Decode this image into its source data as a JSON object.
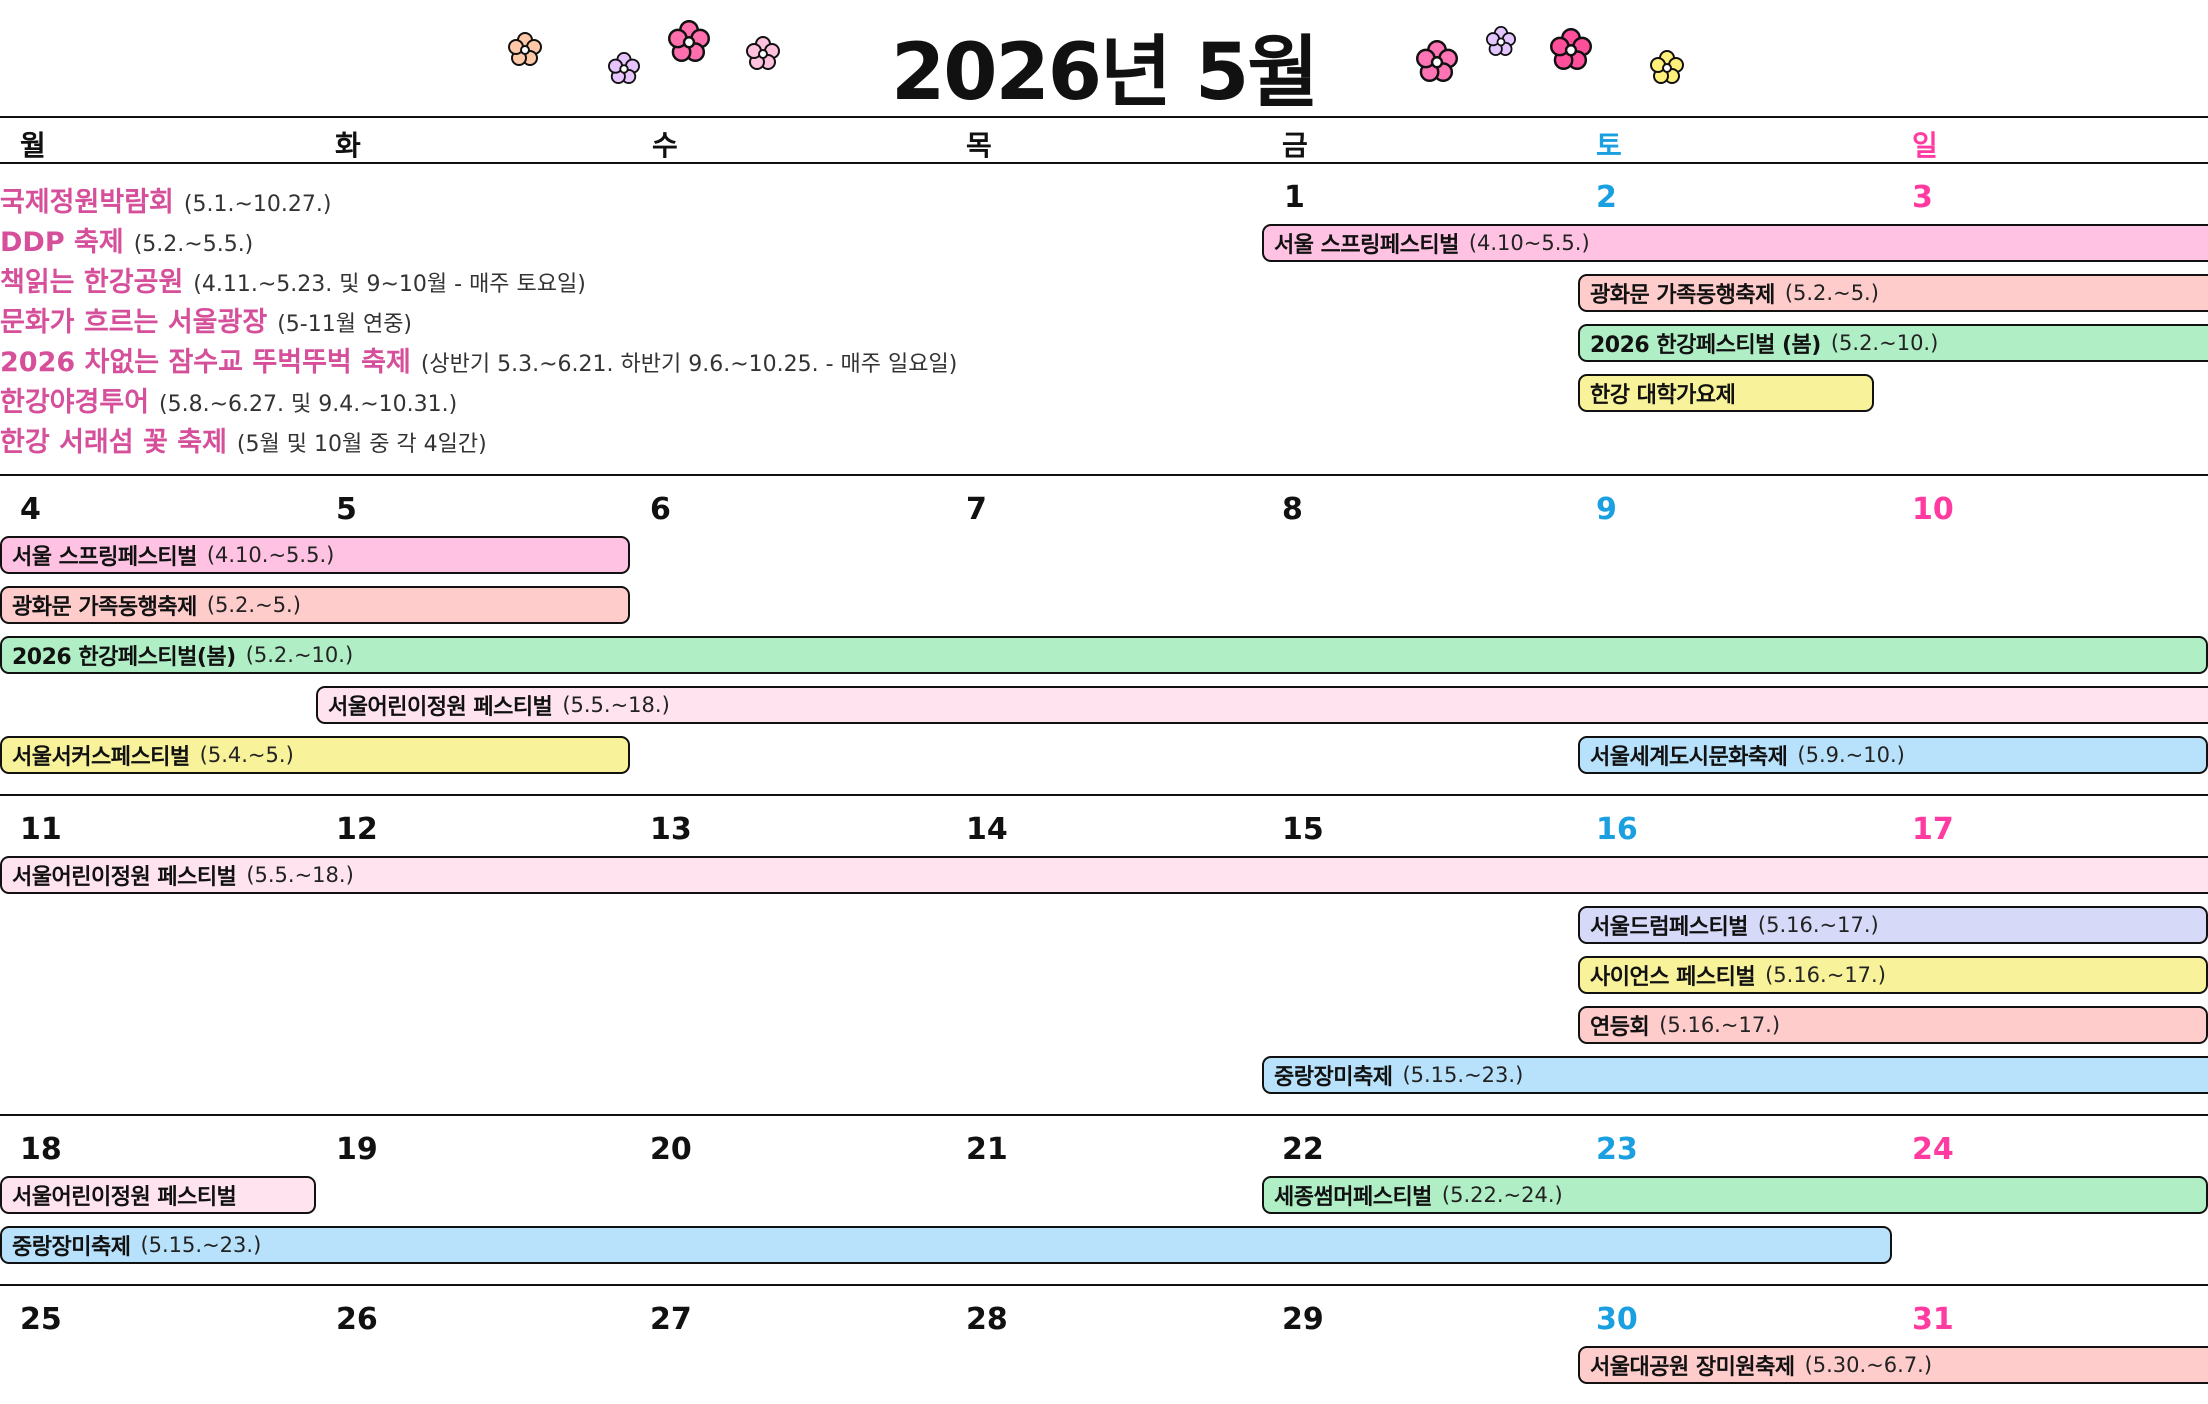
{
  "title": "2026년 5월",
  "weekdays": [
    "월",
    "화",
    "수",
    "목",
    "금",
    "토",
    "일"
  ],
  "colors": {
    "saturday": "#1a9fe0",
    "sunday": "#ff3aa1",
    "info_name": "#d64f9a",
    "pink": "#ffc2e2",
    "salmon": "#ffcccc",
    "green": "#b0eec6",
    "yellow": "#f8f29a",
    "light_pink": "#ffe4f0",
    "blue": "#b8e2fc",
    "lavender": "#d6daf8"
  },
  "decorations": [
    "flower-icon"
  ],
  "info": [
    {
      "name": "국제정원박람회",
      "date": "(5.1.~10.27.)"
    },
    {
      "name": "DDP 축제",
      "date": "(5.2.~5.5.)"
    },
    {
      "name": "책읽는 한강공원",
      "date": "(4.11.~5.23. 및 9~10월 - 매주 토요일)"
    },
    {
      "name": "문화가 흐르는 서울광장",
      "date": "(5-11월 연중)"
    },
    {
      "name": "2026 차없는 잠수교 뚜벅뚜벅 축제",
      "date": "(상반기 5.3.~6.21. 하반기 9.6.~10.25. - 매주 일요일)"
    },
    {
      "name": "한강야경투어",
      "date": "(5.8.~6.27. 및 9.4.~10.31.)"
    },
    {
      "name": "한강 서래섬 꽃 축제",
      "date": "(5월 및 10월 중 각 4일간)"
    }
  ],
  "weeks": [
    {
      "days": [
        "",
        "",
        "",
        "",
        "1",
        "2",
        "3"
      ],
      "events": [
        {
          "name": "서울 스프링페스티벌",
          "date": "(4.10~5.5.)"
        },
        {
          "name": "광화문 가족동행축제",
          "date": "(5.2.~5.)"
        },
        {
          "name": "2026 한강페스티벌 (봄)",
          "date": "(5.2.~10.)"
        },
        {
          "name": "한강 대학가요제",
          "date": ""
        }
      ]
    },
    {
      "days": [
        "4",
        "5",
        "6",
        "7",
        "8",
        "9",
        "10"
      ],
      "events": [
        {
          "name": "서울 스프링페스티벌",
          "date": "(4.10.~5.5.)"
        },
        {
          "name": "광화문 가족동행축제",
          "date": "(5.2.~5.)"
        },
        {
          "name": "2026 한강페스티벌(봄)",
          "date": "(5.2.~10.)"
        },
        {
          "name": "서울어린이정원 페스티벌",
          "date": "(5.5.~18.)"
        },
        {
          "name": "서울서커스페스티벌",
          "date": "(5.4.~5.)"
        },
        {
          "name": "서울세계도시문화축제",
          "date": "(5.9.~10.)"
        }
      ]
    },
    {
      "days": [
        "11",
        "12",
        "13",
        "14",
        "15",
        "16",
        "17"
      ],
      "events": [
        {
          "name": "서울어린이정원 페스티벌",
          "date": "(5.5.~18.)"
        },
        {
          "name": "서울드럼페스티벌",
          "date": "(5.16.~17.)"
        },
        {
          "name": "사이언스 페스티벌",
          "date": "(5.16.~17.)"
        },
        {
          "name": "연등회",
          "date": "(5.16.~17.)"
        },
        {
          "name": "중랑장미축제",
          "date": "(5.15.~23.)"
        }
      ]
    },
    {
      "days": [
        "18",
        "19",
        "20",
        "21",
        "22",
        "23",
        "24"
      ],
      "events": [
        {
          "name": "서울어린이정원 페스티벌",
          "date": ""
        },
        {
          "name": "세종썸머페스티벌",
          "date": "(5.22.~24.)"
        },
        {
          "name": "중랑장미축제",
          "date": "(5.15.~23.)"
        }
      ]
    },
    {
      "days": [
        "25",
        "26",
        "27",
        "28",
        "29",
        "30",
        "31"
      ],
      "events": [
        {
          "name": "서울대공원 장미원축제",
          "date": "(5.30.~6.7.)"
        }
      ]
    }
  ]
}
